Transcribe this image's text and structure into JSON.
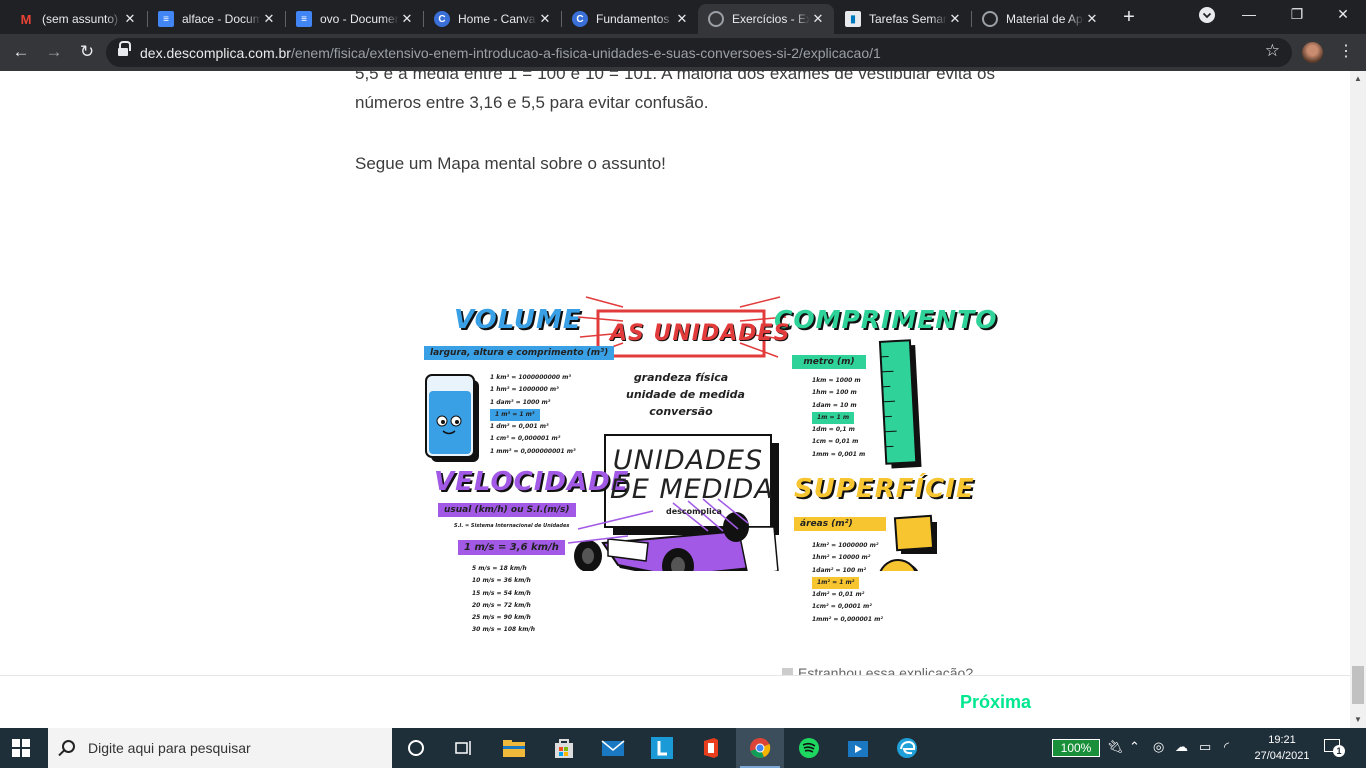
{
  "browser": {
    "tabs": [
      {
        "title": "(sem assunto)",
        "icon": "gmail-icon",
        "active": false
      },
      {
        "title": "alface - Documentos Google",
        "icon": "docs-icon",
        "active": false
      },
      {
        "title": "ovo - Documentos Google",
        "icon": "docs-icon",
        "active": false
      },
      {
        "title": "Home - Canva",
        "icon": "canva-icon",
        "active": false
      },
      {
        "title": "Fundamentos",
        "icon": "canva-icon",
        "active": false
      },
      {
        "title": "Exercícios - Ex",
        "icon": "globe-icon",
        "active": true
      },
      {
        "title": "Tarefas Semanais",
        "icon": "trello-icon",
        "active": false
      },
      {
        "title": "Material de Apoio",
        "icon": "globe-icon",
        "active": false
      }
    ],
    "url_host": "dex.descomplica.com.br",
    "url_path": "/enem/fisica/extensivo-enem-introducao-a-fisica-unidades-e-suas-conversoes-si-2/explicacao/1"
  },
  "content": {
    "paragraph_1": "5,5 é a média entre 1 = 100 e 10 = 101. A maioria dos exames de vestibular evita os números entre 3,16 e 5,5 para evitar confusão.",
    "paragraph_2": "Segue um Mapa mental sobre o assunto!",
    "feedback_label": "Estranhou essa explicação?",
    "next_label": "Próxima"
  },
  "mindmap": {
    "title": "AS UNIDADES",
    "center_title_1": "UNIDADES",
    "center_title_2": "DE MEDIDA",
    "brand": "descomplica",
    "intro_1": "grandeza física",
    "intro_2": "unidade de medida",
    "intro_3": "conversão",
    "volume": {
      "title": "VOLUME",
      "subtitle": "largura, altura e comprimento (m³)",
      "items": [
        "1 km³ = 1000000000 m³",
        "1 hm³ = 1000000 m³",
        "1 dam³ = 1000 m³",
        "1 m³ = 1 m³",
        "1 dm³ = 0,001 m³",
        "1 cm³ = 0,000001 m³",
        "1 mm³ = 0,000000001 m³"
      ]
    },
    "comprimento": {
      "title": "COMPRIMENTO",
      "subtitle": "metro (m)",
      "items": [
        "1km = 1000 m",
        "1hm = 100 m",
        "1dam = 10 m",
        "1m = 1 m",
        "1dm = 0,1 m",
        "1cm = 0,01 m",
        "1mm = 0,001 m"
      ]
    },
    "velocidade": {
      "title": "VELOCIDADE",
      "subtitle": "usual (km/h) ou S.I.(m/s)",
      "note": "S.I. = Sistema Internacional de Unidades",
      "highlight": "1 m/s = 3,6 km/h",
      "items": [
        "5 m/s = 18 km/h",
        "10 m/s = 36 km/h",
        "15 m/s = 54 km/h",
        "20 m/s = 72 km/h",
        "25 m/s = 90 km/h",
        "30 m/s = 108 km/h"
      ]
    },
    "superficie": {
      "title": "SUPERFÍCIE",
      "subtitle": "áreas (m²)",
      "items": [
        "1km² = 1000000 m²",
        "1hm² = 10000 m²",
        "1dam² = 100 m²",
        "1m² = 1 m²",
        "1dm² = 0,01 m²",
        "1cm² = 0,0001 m²",
        "1mm² = 0,000001 m²"
      ]
    },
    "colors": {
      "volume": "#3aa0e6",
      "comprimento": "#2fd39a",
      "velocidade": "#a25ae6",
      "superficie": "#f7c530",
      "title_red": "#e23b3b"
    }
  },
  "taskbar": {
    "search_placeholder": "Digite aqui para pesquisar",
    "battery": "100%",
    "time": "19:21",
    "date": "27/04/2021",
    "notifications": "1"
  }
}
